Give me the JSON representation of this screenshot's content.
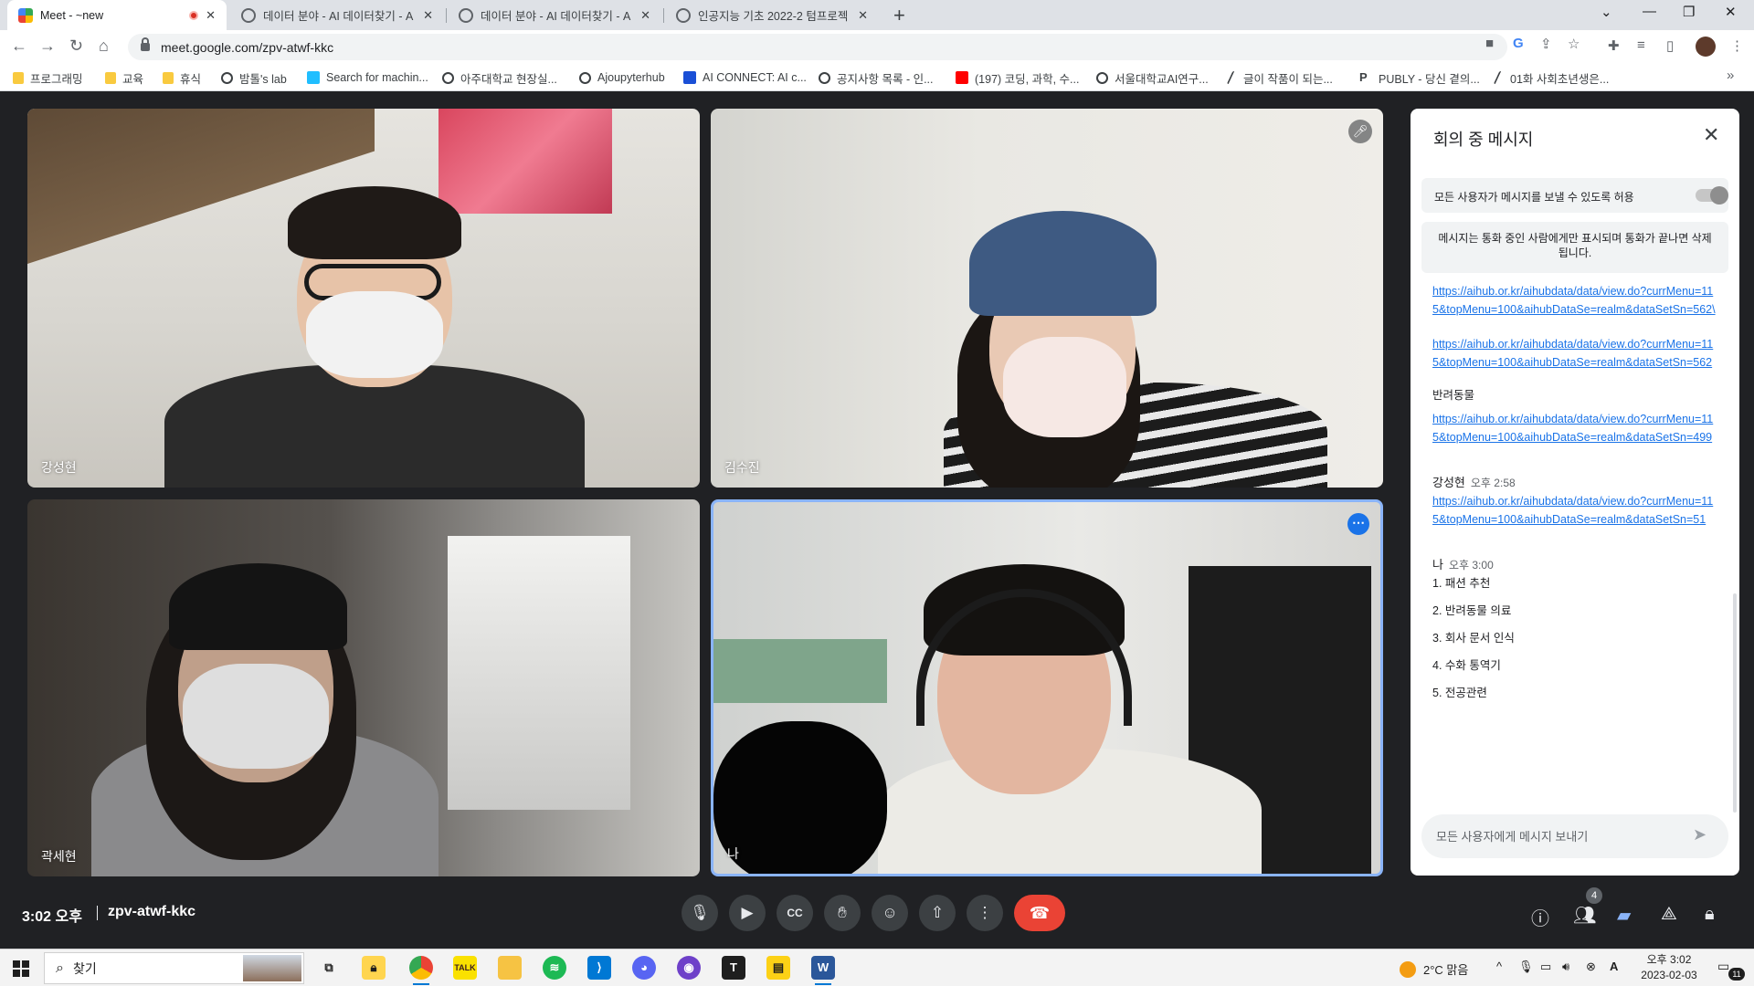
{
  "browser": {
    "tabs": [
      {
        "title": "Meet - ~new",
        "active": true,
        "recording": true
      },
      {
        "title": "데이터 분야 - AI 데이터찾기 - A",
        "active": false
      },
      {
        "title": "데이터 분야 - AI 데이터찾기 - A",
        "active": false
      },
      {
        "title": "인공지능 기초 2022-2 텀프로젝",
        "active": false
      }
    ],
    "url": "meet.google.com/zpv-atwf-kkc",
    "bookmarks": [
      {
        "label": "프로그래밍",
        "icon": "folder-icon"
      },
      {
        "label": "교육",
        "icon": "folder-icon"
      },
      {
        "label": "휴식",
        "icon": "folder-icon"
      },
      {
        "label": "밤톨's lab",
        "icon": "globe-icon"
      },
      {
        "label": "Search for machin...",
        "icon": "kaggle-icon"
      },
      {
        "label": "아주대학교 현장실...",
        "icon": "globe-icon"
      },
      {
        "label": "Ajoupyterhub",
        "icon": "globe-icon"
      },
      {
        "label": "AI CONNECT: AI c...",
        "icon": "ai-connect-icon"
      },
      {
        "label": "공지사항 목록 - 인...",
        "icon": "globe-icon"
      },
      {
        "label": "(197) 코딩, 과학, 수...",
        "icon": "youtube-icon"
      },
      {
        "label": "서울대학교AI연구...",
        "icon": "globe-icon"
      },
      {
        "label": "글이 작품이 되는...",
        "icon": "pen-icon"
      },
      {
        "label": "PUBLY - 당신 곁의...",
        "icon": "publy-icon"
      },
      {
        "label": "01화 사회초년생은...",
        "icon": "pen-icon"
      }
    ]
  },
  "meet": {
    "participants": [
      {
        "name": "강성현"
      },
      {
        "name": "김수진"
      },
      {
        "name": "곽세현"
      },
      {
        "name": "나"
      }
    ],
    "time": "3:02 오후",
    "code": "zpv-atwf-kkc",
    "people_count": "4",
    "chat": {
      "title": "회의 중 메시지",
      "allow_label": "모든 사용자가 메시지를 보낼 수 있도록 허용",
      "notice": "메시지는 통화 중인 사람에게만 표시되며 통화가 끝나면 삭제됩니다.",
      "link1": "https://aihub.or.kr/aihubdata/data/view.do?currMenu=115&topMenu=100&aihubDataSe=realm&dataSetSn=562\\",
      "link2": "https://aihub.or.kr/aihubdata/data/view.do?currMenu=115&topMenu=100&aihubDataSe=realm&dataSetSn=562",
      "text_pets": "반려동물",
      "link3": "https://aihub.or.kr/aihubdata/data/view.do?currMenu=115&topMenu=100&aihubDataSe=realm&dataSetSn=499",
      "msg2_sender": "강성현",
      "msg2_time": "오후 2:58",
      "link4": "https://aihub.or.kr/aihubdata/data/view.do?currMenu=115&topMenu=100&aihubDataSe=realm&dataSetSn=51",
      "msg3_sender": "나",
      "msg3_time": "오후 3:00",
      "list": [
        "1. 패션 추천",
        "2. 반려동물 의료",
        "3. 회사 문서 인식",
        "4. 수화 통역기",
        "5. 전공관련"
      ],
      "input_placeholder": "모든 사용자에게 메시지 보내기"
    }
  },
  "taskbar": {
    "search_label": "찾기",
    "weather": "2°C  맑음",
    "clock_time": "오후 3:02",
    "clock_date": "2023-02-03",
    "notif_count": "11",
    "ime": "A"
  },
  "colors": {
    "meet_bg": "#202124",
    "accent": "#1a73e8",
    "end_call": "#ea4335",
    "active_tile_border": "#8ab4f8"
  }
}
